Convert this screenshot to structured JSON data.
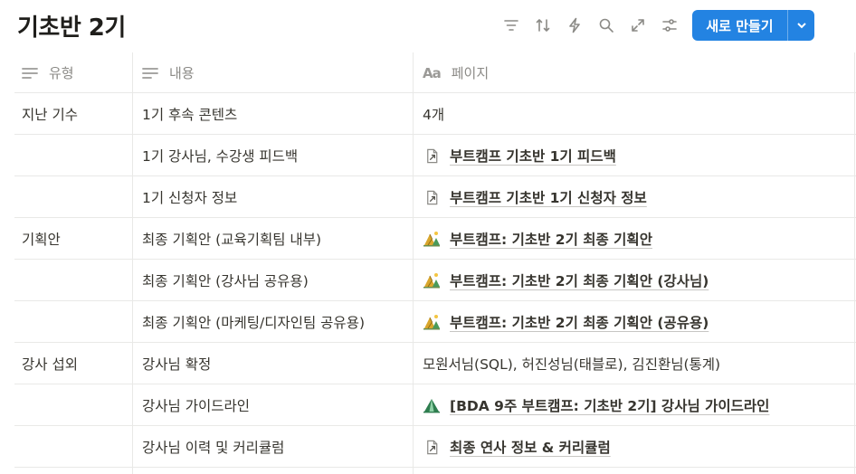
{
  "page": {
    "title": "기초반 2기"
  },
  "toolbar": {
    "icons": [
      "filter-icon",
      "sort-icon",
      "automation-icon",
      "search-icon",
      "expand-icon",
      "settings-icon"
    ],
    "new_button_label": "새로 만들기"
  },
  "columns": [
    {
      "label": "유형",
      "icon": "list-icon"
    },
    {
      "label": "내용",
      "icon": "list-icon"
    },
    {
      "label": "페이지",
      "icon": "text-icon",
      "icon_text": "Aa"
    }
  ],
  "rows": [
    {
      "type": "지난 기수",
      "content": "1기 후속 콘텐츠",
      "page": "4개",
      "page_icon": "none"
    },
    {
      "type": "",
      "content": "1기 강사님, 수강생 피드백",
      "page": "부트캠프 기초반 1기 피드백",
      "page_icon": "doc-link-icon"
    },
    {
      "type": "",
      "content": "1기 신청자 정보",
      "page": "부트캠프 기초반 1기 신청자 정보",
      "page_icon": "doc-link-icon"
    },
    {
      "type": "기획안",
      "content": "최종 기획안 (교육기획팀 내부)",
      "page": "부트캠프: 기초반 2기 최종 기획안",
      "page_icon": "camp-icon"
    },
    {
      "type": "",
      "content": "최종 기획안 (강사님 공유용)",
      "page": "부트캠프: 기초반 2기 최종 기획안 (강사님)",
      "page_icon": "camp-icon"
    },
    {
      "type": "",
      "content": "최종 기획안 (마케팅/디자인팀 공유용)",
      "page": "부트캠프: 기초반 2기 최종 기획안 (공유용)",
      "page_icon": "camp-icon"
    },
    {
      "type": "강사 섭외",
      "content": "강사님 확정",
      "page": "모원서님(SQL), 허진성님(태블로), 김진환님(통계)",
      "page_icon": "none"
    },
    {
      "type": "",
      "content": "강사님 가이드라인",
      "page": "[BDA 9주 부트캠프: 기초반 2기] 강사님 가이드라인",
      "page_icon": "tent-icon"
    },
    {
      "type": "",
      "content": "강사님 이력 및 커리큘럼",
      "page": "최종 연사 정보 & 커리큘럼",
      "page_icon": "doc-link-icon"
    }
  ],
  "colors": {
    "accent": "#2383e2",
    "border": "#e9e9e7",
    "text": "#37352f",
    "muted": "#8b8a86"
  }
}
